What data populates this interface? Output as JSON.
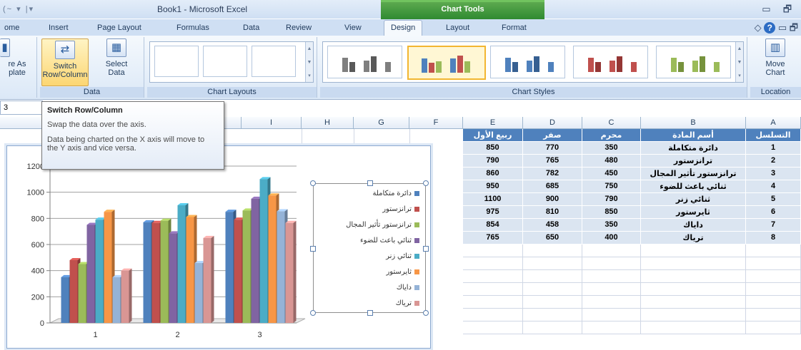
{
  "title_bar": {
    "qat": "(~ ▾ |▾",
    "app_title": "Book1 - Microsoft Excel",
    "contextual_group": "Chart Tools",
    "min": "▭",
    "restore": "🗗"
  },
  "tabs": [
    "ome",
    "Insert",
    "Page Layout",
    "Formulas",
    "Data",
    "Review",
    "View",
    "Design",
    "Layout",
    "Format"
  ],
  "active_tab": "Design",
  "help_controls": {
    "caret": "◇",
    "help": "?",
    "min": "▭",
    "restore": "🗗"
  },
  "ribbon": {
    "save_template": {
      "line1": "re As",
      "line2": "plate"
    },
    "switch_row_col": {
      "line1": "Switch",
      "line2": "Row/Column"
    },
    "select_data": {
      "line1": "Select",
      "line2": "Data"
    },
    "data_group_label": "Data",
    "chart_layouts_label": "Chart Layouts",
    "chart_styles_label": "Chart Styles",
    "move_chart": {
      "line1": "Move",
      "line2": "Chart"
    },
    "location_label": "Location"
  },
  "namebox": "3",
  "tooltip": {
    "title": "Switch Row/Column",
    "line1": "Swap the data over the axis.",
    "line2": "Data being charted on the X axis will move to the Y axis and vice versa."
  },
  "columns": [
    "I",
    "H",
    "G",
    "F",
    "E",
    "D",
    "C",
    "B",
    "A"
  ],
  "table": {
    "headers": {
      "A": "التسلسل",
      "B": "أسم المادة",
      "C": "محرم",
      "D": "صفر",
      "E": "ربيع الأول"
    },
    "rows": [
      {
        "A": "1",
        "B": "دائرة متكاملة",
        "C": "350",
        "D": "770",
        "E": "850"
      },
      {
        "A": "2",
        "B": "ترانزستور",
        "C": "480",
        "D": "765",
        "E": "790"
      },
      {
        "A": "3",
        "B": "ترانزستور تأثير المجال",
        "C": "450",
        "D": "782",
        "E": "860"
      },
      {
        "A": "4",
        "B": "ثنائي باعث للضوء",
        "C": "750",
        "D": "685",
        "E": "950"
      },
      {
        "A": "5",
        "B": "ثنائي زنر",
        "C": "790",
        "D": "900",
        "E": "1100"
      },
      {
        "A": "6",
        "B": "ثايرستور",
        "C": "850",
        "D": "810",
        "E": "975"
      },
      {
        "A": "7",
        "B": "داياك",
        "C": "350",
        "D": "458",
        "E": "854"
      },
      {
        "A": "8",
        "B": "ترياك",
        "C": "400",
        "D": "650",
        "E": "765"
      }
    ]
  },
  "colors": {
    "s1": "#4f81bd",
    "s2": "#c0504d",
    "s3": "#9bbb59",
    "s4": "#8064a2",
    "s5": "#4bacc6",
    "s6": "#f79646",
    "s7": "#95b3d7",
    "s8": "#d99694"
  },
  "chart_data": {
    "type": "bar",
    "categories": [
      "1",
      "2",
      "3"
    ],
    "ylim": [
      0,
      1200
    ],
    "yticks": [
      "0",
      "200",
      "400",
      "600",
      "800",
      "1000",
      "1200"
    ],
    "legend_position": "right",
    "series": [
      {
        "name": "دائرة متكاملة",
        "values": [
          350,
          770,
          850
        ]
      },
      {
        "name": "ترانزستور",
        "values": [
          480,
          765,
          790
        ]
      },
      {
        "name": "ترانزستور تأثير المجال",
        "values": [
          450,
          782,
          860
        ]
      },
      {
        "name": "ثنائي باعث للضوء",
        "values": [
          750,
          685,
          950
        ]
      },
      {
        "name": "ثنائي زنر",
        "values": [
          790,
          900,
          1100
        ]
      },
      {
        "name": "ثايرستور",
        "values": [
          850,
          810,
          975
        ]
      },
      {
        "name": "داياك",
        "values": [
          350,
          458,
          854
        ]
      },
      {
        "name": "ترياك",
        "values": [
          400,
          650,
          765
        ]
      }
    ]
  }
}
